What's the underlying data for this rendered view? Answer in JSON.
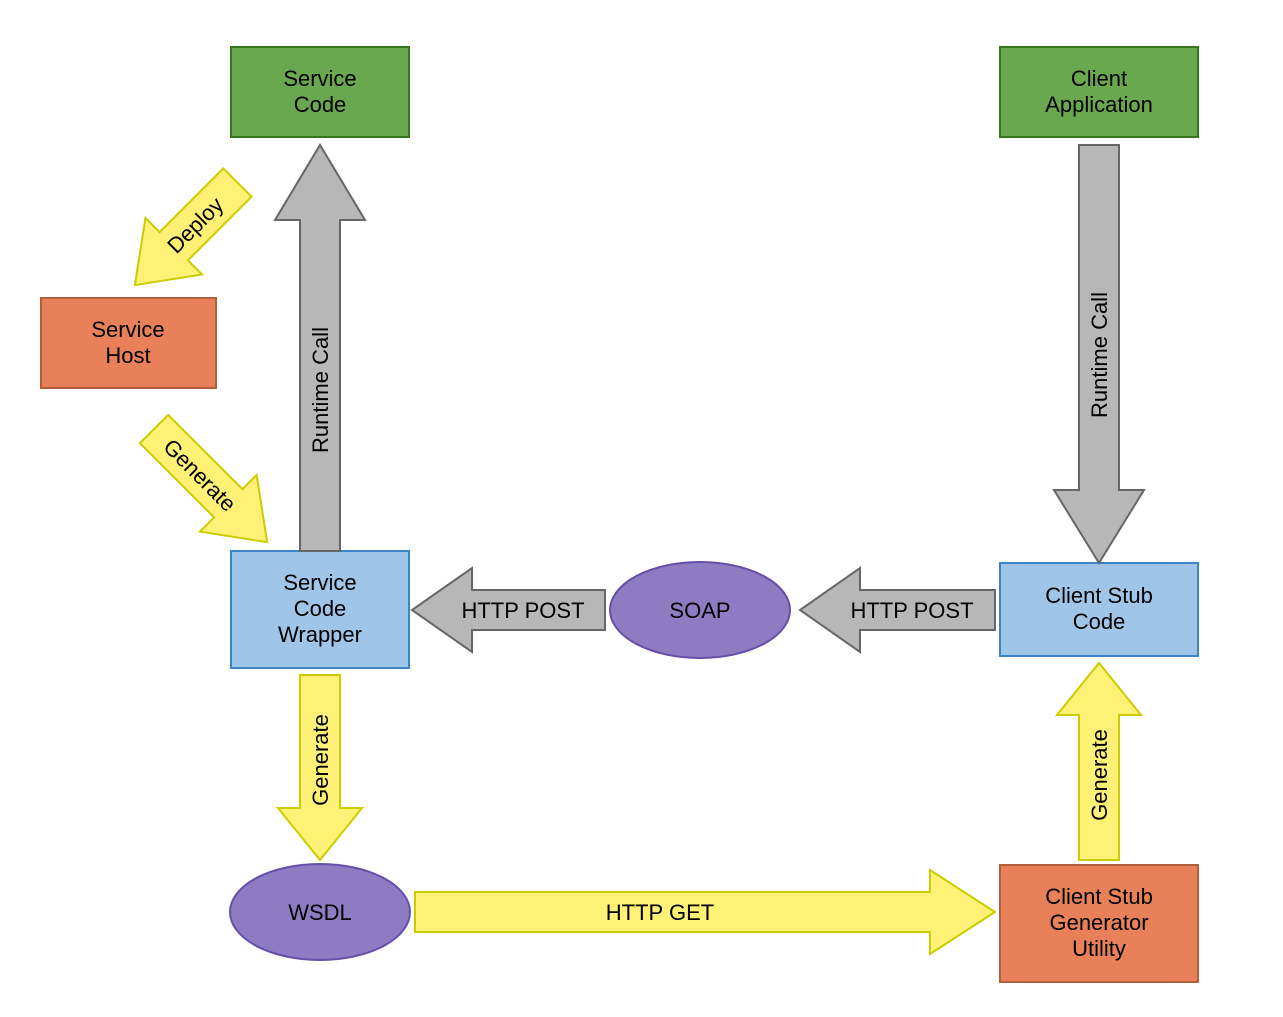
{
  "nodes": {
    "service_code": {
      "line1": "Service",
      "line2": "Code"
    },
    "client_app": {
      "line1": "Client",
      "line2": "Application"
    },
    "service_host": {
      "line1": "Service",
      "line2": "Host"
    },
    "svc_wrapper": {
      "line1": "Service",
      "line2": "Code",
      "line3": "Wrapper"
    },
    "soap": {
      "label": "SOAP"
    },
    "client_stub": {
      "line1": "Client Stub",
      "line2": "Code"
    },
    "wsdl": {
      "label": "WSDL"
    },
    "stub_gen": {
      "line1": "Client Stub",
      "line2": "Generator",
      "line3": "Utility"
    }
  },
  "arrows": {
    "deploy": "Deploy",
    "generate1": "Generate",
    "runtime_left": "Runtime Call",
    "runtime_right": "Runtime Call",
    "http_post_l": "HTTP POST",
    "http_post_r": "HTTP POST",
    "generate2": "Generate",
    "generate3": "Generate",
    "http_get": "HTTP GET"
  },
  "colors": {
    "green_fill": "#6aa84f",
    "green_stroke": "#38761d",
    "orange_fill": "#e8805a",
    "orange_stroke": "#b45f3c",
    "blue_fill": "#9fc5e8",
    "blue_stroke": "#3d85c6",
    "purple_fill": "#8e7cc3",
    "purple_stroke": "#674ea7",
    "grey_fill": "#b7b7b7",
    "grey_stroke": "#666666",
    "yellow_fill": "#fff175",
    "yellow_stroke": "#cccc00"
  }
}
